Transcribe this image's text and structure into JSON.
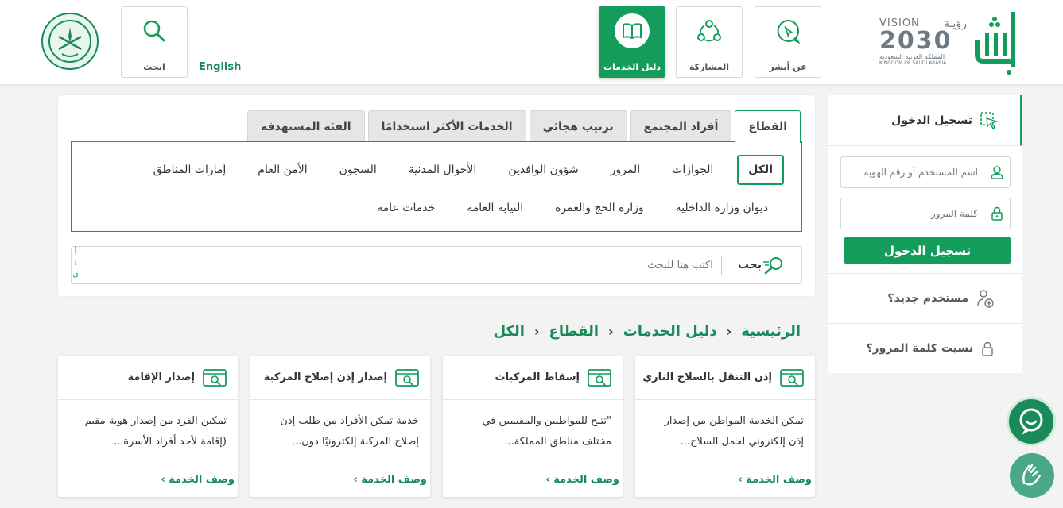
{
  "header": {
    "nav": [
      {
        "label": "عن أبشر",
        "icon": "chat-icon"
      },
      {
        "label": "المشاركة",
        "icon": "share-icon"
      },
      {
        "label": "دليل الخدمات",
        "icon": "book-icon",
        "active": true
      }
    ],
    "search_tile": {
      "label": "ابحث",
      "icon": "search-icon"
    },
    "language": "English",
    "vision": {
      "top": "VISION",
      "ruya": "رؤيـة",
      "year": "2030",
      "ar": "المملكة العربية السعودية",
      "en": "KINGDOM OF SAUDI ARABIA"
    }
  },
  "tabs": [
    "القطاع",
    "أفراد المجتمع",
    "ترتيب هجائي",
    "الخدمات الأكثر استخدامًا",
    "الفئة المستهدفة"
  ],
  "sectors": {
    "row1": [
      "الكل",
      "الجوازات",
      "المرور",
      "شؤون الوافدين",
      "الأحوال المدنية",
      "السجون",
      "الأمن العام",
      "إمارات المناطق"
    ],
    "row2": [
      "ديوان وزارة الداخلية",
      "وزارة الحج والعمرة",
      "النيابة العامة",
      "خدمات عامة"
    ]
  },
  "search": {
    "label": "بحث",
    "placeholder": "اكتب هنا للبحث",
    "kbd_toggle": "أ\n↓\nى"
  },
  "breadcrumb": [
    "الرئيسية",
    "دليل الخدمات",
    "القطاع",
    "الكل"
  ],
  "breadcrumb_sep": "›",
  "services": [
    {
      "title": "إذن التنقل بالسلاح الناري",
      "desc": "تمكن الخدمة المواطن من إصدار إذن إلكتروني لحمل السلاح...",
      "more": "وصف الخدمة ›"
    },
    {
      "title": "إسقاط المركبات",
      "desc": "\"تتيح للمواطنين والمقيمين في مختلف مناطق المملكة...",
      "more": "وصف الخدمة ›"
    },
    {
      "title": "إصدار إذن إصلاح المركبة",
      "desc": "خدمة تمكن الأفراد من طلب إذن إصلاح المركبة إلكترونيًا دون...",
      "more": "وصف الخدمة ›"
    },
    {
      "title": "إصدار الإقامة",
      "desc": "تمكين الفرد من إصدار هوية مقيم (إقامة لأحد أفراد الأسرة...",
      "more": "وصف الخدمة ›"
    }
  ],
  "sidebar": {
    "login_title": "تسجيل الدخول",
    "username_placeholder": "اسم المستخدم أو رقم الهوية",
    "password_placeholder": "كلمة المرور",
    "login_button": "تسجيل الدخول",
    "new_user": "مستخدم جديد؟",
    "forgot_password": "نسيت كلمة المرور؟"
  },
  "colors": {
    "brand_green": "#149c5b",
    "text_green": "#178a5a"
  }
}
